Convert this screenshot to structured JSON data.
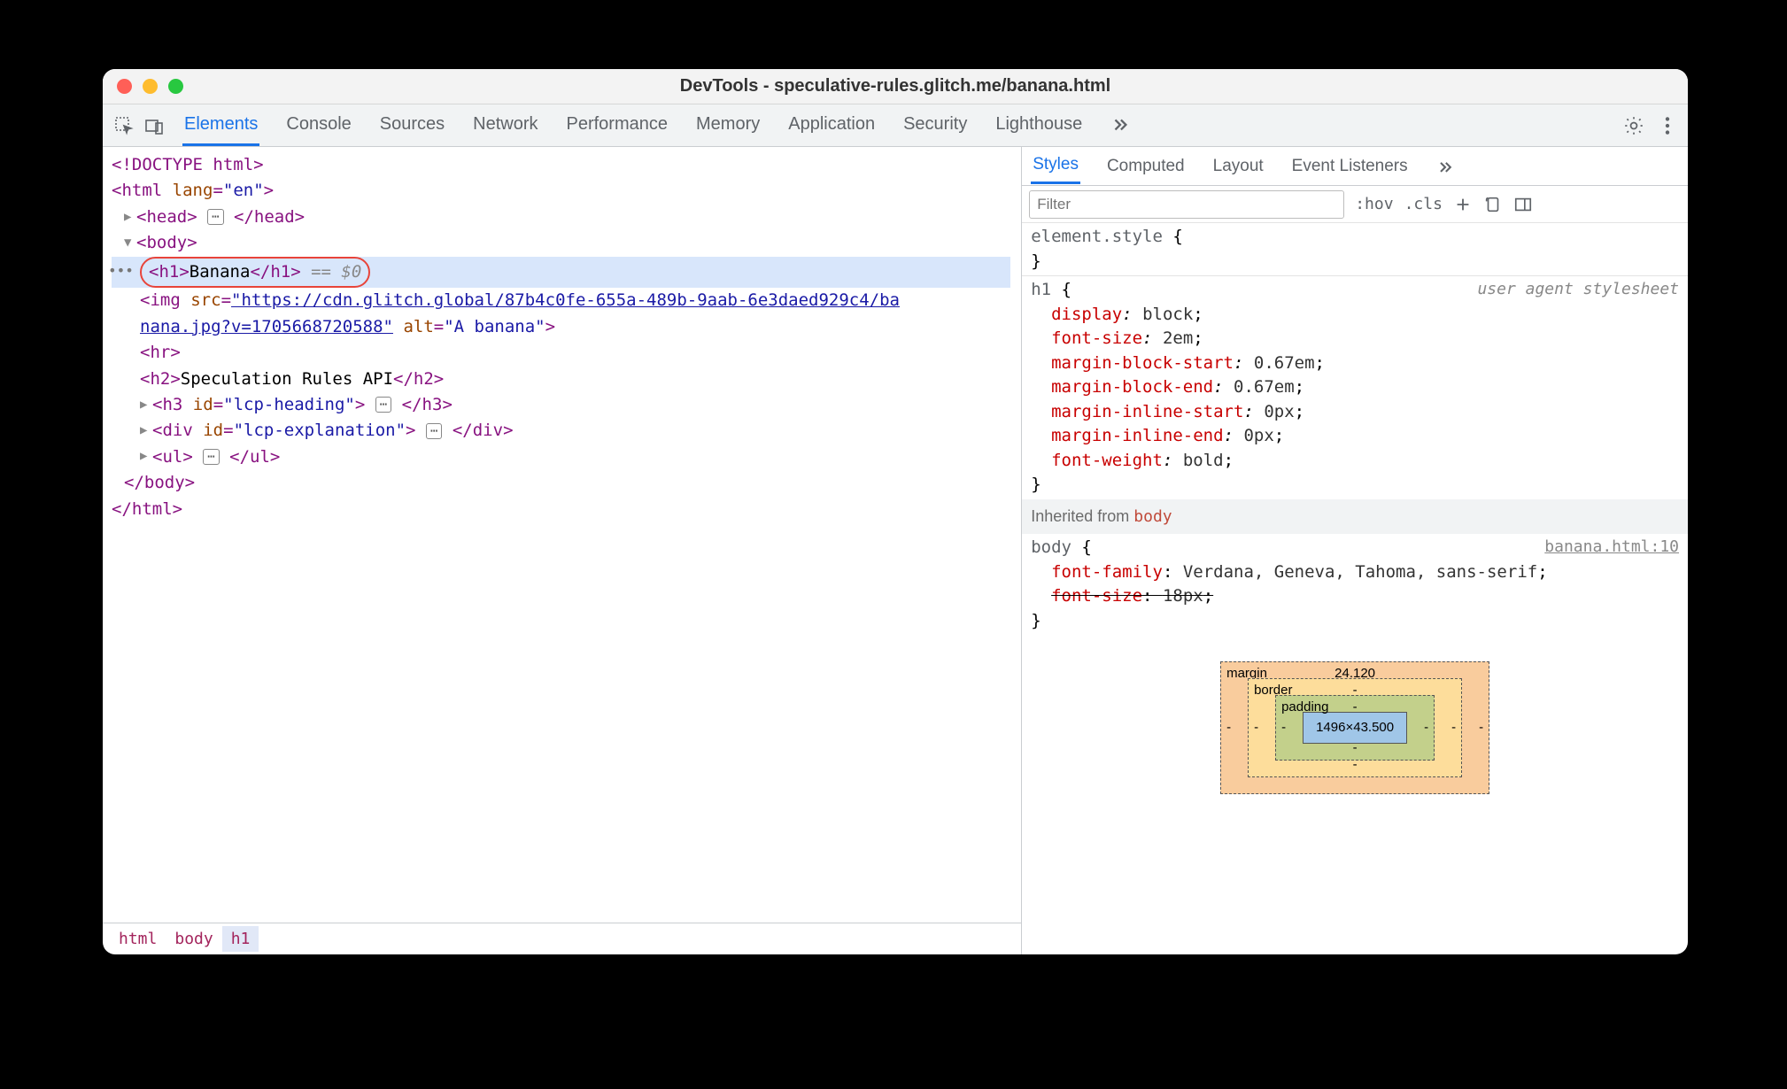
{
  "window": {
    "title": "DevTools - speculative-rules.glitch.me/banana.html"
  },
  "tabs": [
    "Elements",
    "Console",
    "Sources",
    "Network",
    "Performance",
    "Memory",
    "Application",
    "Security",
    "Lighthouse"
  ],
  "tabs_active": 0,
  "dom": {
    "doctype": "<!DOCTYPE html>",
    "html_open": "html",
    "html_lang_attr": "lang",
    "html_lang_val": "\"en\"",
    "head": "head",
    "body": "body",
    "h1_tag": "h1",
    "h1_text": "Banana",
    "h1_sel": " == $0",
    "img_tag": "img",
    "img_src_attr": "src",
    "img_src_val1": "\"https://cdn.glitch.global/87b4c0fe-655a-489b-9aab-6e3daed929c4/ba",
    "img_src_val2": "nana.jpg?v=1705668720588\"",
    "img_alt_attr": "alt",
    "img_alt_val": "\"A banana\"",
    "hr_tag": "hr",
    "h2_tag": "h2",
    "h2_text": "Speculation Rules API",
    "h3_tag": "h3",
    "h3_id_attr": "id",
    "h3_id_val": "\"lcp-heading\"",
    "div_tag": "div",
    "div_id_attr": "id",
    "div_id_val": "\"lcp-explanation\"",
    "ul_tag": "ul"
  },
  "breadcrumb": [
    "html",
    "body",
    "h1"
  ],
  "styles": {
    "tabs": [
      "Styles",
      "Computed",
      "Layout",
      "Event Listeners"
    ],
    "tabs_active": 0,
    "filter_placeholder": "Filter",
    "hov": ":hov",
    "cls": ".cls",
    "blocks": [
      {
        "selector": "element.style",
        "props": []
      },
      {
        "selector": "h1",
        "source": "user agent stylesheet",
        "source_link": false,
        "props": [
          {
            "p": "display",
            "v": "block"
          },
          {
            "p": "font-size",
            "v": "2em"
          },
          {
            "p": "margin-block-start",
            "v": "0.67em"
          },
          {
            "p": "margin-block-end",
            "v": "0.67em"
          },
          {
            "p": "margin-inline-start",
            "v": "0px"
          },
          {
            "p": "margin-inline-end",
            "v": "0px"
          },
          {
            "p": "font-weight",
            "v": "bold"
          }
        ]
      }
    ],
    "inherited_label": "Inherited from ",
    "inherited_el": "body",
    "body_block": {
      "selector": "body",
      "source": "banana.html:10",
      "source_link": true,
      "props": [
        {
          "p": "font-family",
          "v": "Verdana, Geneva, Tahoma, sans-serif"
        },
        {
          "p": "font-size",
          "v": "18px",
          "strike": true
        }
      ]
    }
  },
  "box_model": {
    "margin_label": "margin",
    "margin_top": "24.120",
    "border_label": "border",
    "padding_label": "padding",
    "content": "1496×43.500",
    "dash": "-"
  }
}
